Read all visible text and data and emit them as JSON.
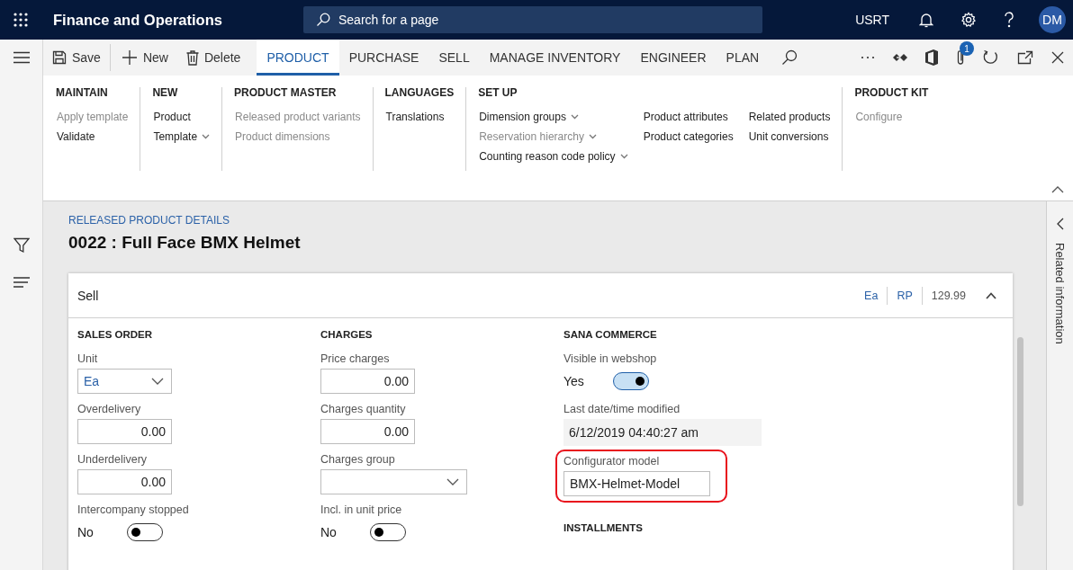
{
  "top_bar": {
    "app_title": "Finance and Operations",
    "search_placeholder": "Search for a page",
    "company": "USRT",
    "avatar_initials": "DM"
  },
  "action_pane": {
    "buttons": [
      {
        "label": "Save",
        "kind": "save"
      },
      {
        "label": "New",
        "kind": "new"
      },
      {
        "label": "Delete",
        "kind": "delete"
      }
    ],
    "tabs": [
      {
        "label": "PRODUCT",
        "selected": true
      },
      {
        "label": "PURCHASE",
        "selected": false
      },
      {
        "label": "SELL",
        "selected": false
      },
      {
        "label": "MANAGE INVENTORY",
        "selected": false
      },
      {
        "label": "ENGINEER",
        "selected": false
      },
      {
        "label": "PLAN",
        "selected": false
      }
    ],
    "attachment_count": "1"
  },
  "ribbon": {
    "groups": [
      {
        "title": "MAINTAIN",
        "columns": [
          [
            {
              "label": "Apply template",
              "disabled": true,
              "dropdown": false
            },
            {
              "label": "Validate",
              "disabled": false,
              "dropdown": false
            }
          ]
        ]
      },
      {
        "title": "NEW",
        "columns": [
          [
            {
              "label": "Product",
              "disabled": false,
              "dropdown": false
            },
            {
              "label": "Template",
              "disabled": false,
              "dropdown": true
            }
          ]
        ]
      },
      {
        "title": "PRODUCT MASTER",
        "columns": [
          [
            {
              "label": "Released product variants",
              "disabled": true,
              "dropdown": false
            },
            {
              "label": "Product dimensions",
              "disabled": true,
              "dropdown": false
            }
          ]
        ]
      },
      {
        "title": "LANGUAGES",
        "columns": [
          [
            {
              "label": "Translations",
              "disabled": false,
              "dropdown": false
            }
          ]
        ]
      },
      {
        "title": "SET UP",
        "columns": [
          [
            {
              "label": "Dimension groups",
              "disabled": false,
              "dropdown": true
            },
            {
              "label": "Reservation hierarchy",
              "disabled": true,
              "dropdown": true
            },
            {
              "label": "Counting reason code policy",
              "disabled": false,
              "dropdown": true
            }
          ],
          [
            {
              "label": "Product attributes",
              "disabled": false,
              "dropdown": false
            },
            {
              "label": "Product categories",
              "disabled": false,
              "dropdown": false
            }
          ],
          [
            {
              "label": "Related products",
              "disabled": false,
              "dropdown": false
            },
            {
              "label": "Unit conversions",
              "disabled": false,
              "dropdown": false
            }
          ]
        ]
      },
      {
        "title": "PRODUCT KIT",
        "columns": [
          [
            {
              "label": "Configure",
              "disabled": true,
              "dropdown": false
            }
          ]
        ]
      }
    ],
    "expanded": true
  },
  "page": {
    "caption": "RELEASED PRODUCT DETAILS",
    "title": "0022 : Full Face BMX Helmet"
  },
  "related_panel": {
    "label": "Related information"
  },
  "fasttab": {
    "title": "Sell",
    "expanded": true,
    "summary": [
      {
        "text": "Ea",
        "kind": "link"
      },
      {
        "text": "RP",
        "kind": "link"
      },
      {
        "text": "129.99",
        "kind": "text"
      }
    ],
    "columns": [
      [
        {
          "kind": "heading",
          "label": "SALES ORDER"
        },
        {
          "kind": "dropdown",
          "label": "Unit",
          "value": "Ea"
        },
        {
          "kind": "number",
          "label": "Overdelivery",
          "value": "0.00"
        },
        {
          "kind": "number",
          "label": "Underdelivery",
          "value": "0.00"
        },
        {
          "kind": "toggle",
          "label": "Intercompany stopped",
          "value": "No",
          "on": false
        }
      ],
      [
        {
          "kind": "heading",
          "label": "CHARGES"
        },
        {
          "kind": "number",
          "label": "Price charges",
          "value": "0.00"
        },
        {
          "kind": "number",
          "label": "Charges quantity",
          "value": "0.00"
        },
        {
          "kind": "dropdown",
          "label": "Charges group"
        },
        {
          "kind": "toggle",
          "label": "Incl. in unit price",
          "value": "No",
          "on": false
        }
      ],
      [
        {
          "kind": "heading",
          "label": "SANA COMMERCE"
        },
        {
          "kind": "toggle",
          "label": "Visible in webshop",
          "value": "Yes",
          "on": true
        },
        {
          "kind": "readonly",
          "label": "Last date/time modified",
          "value": "6/12/2019 04:40:27 am"
        },
        {
          "kind": "text",
          "label": "Configurator model",
          "value": "BMX-Helmet-Model",
          "highlighted": true
        },
        {
          "kind": "heading",
          "label": "INSTALLMENTS"
        }
      ]
    ]
  }
}
